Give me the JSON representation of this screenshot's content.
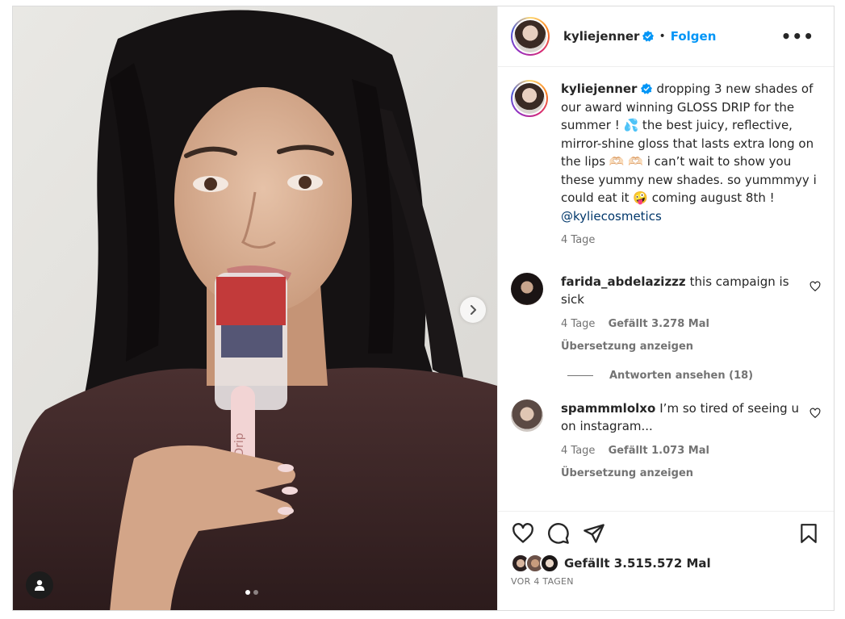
{
  "post": {
    "author": "kyliejenner",
    "follow_label": "Folgen",
    "separator": "•",
    "more_label": "•••",
    "caption_user": "kyliejenner",
    "caption_text": "dropping 3 new shades of our award winning GLOSS DRIP for the summer ! 💦 the best juicy, reflective, mirror-shine gloss that lasts extra long on the lips 🫶🏻 🫶🏻 i can’t wait to show you these yummy new shades. so yummmyy i could eat it 🤪 coming august 8th ! ",
    "caption_mention": "@kyliecosmetics",
    "caption_age": "4 Tage",
    "carousel": {
      "slide_count": 2,
      "active_index": 0
    }
  },
  "comments": [
    {
      "user": "farida_abdelazizzz",
      "text": "this campaign is sick",
      "age": "4 Tage",
      "likes": "Gefällt 3.278 Mal",
      "translate": "Übersetzung anzeigen",
      "replies": "Antworten ansehen (18)"
    },
    {
      "user": "spammmlolxo",
      "text": "I’m so tired of seeing u on instagram...",
      "age": "4 Tage",
      "likes": "Gefällt 1.073 Mal",
      "translate": "Übersetzung anzeigen"
    }
  ],
  "footer": {
    "likes_text": "Gefällt 3.515.572 Mal",
    "timestamp": "VOR 4 TAGEN"
  },
  "icons": {
    "like": "heart-icon",
    "comment": "comment-icon",
    "share": "share-icon",
    "save": "bookmark-icon",
    "next": "chevron-right-icon",
    "tag": "user-icon",
    "verified": "verified-badge-icon"
  },
  "colors": {
    "accent": "#0095f6",
    "mention": "#00376b",
    "secondary_text": "#737373",
    "verified": "#0095f6"
  }
}
